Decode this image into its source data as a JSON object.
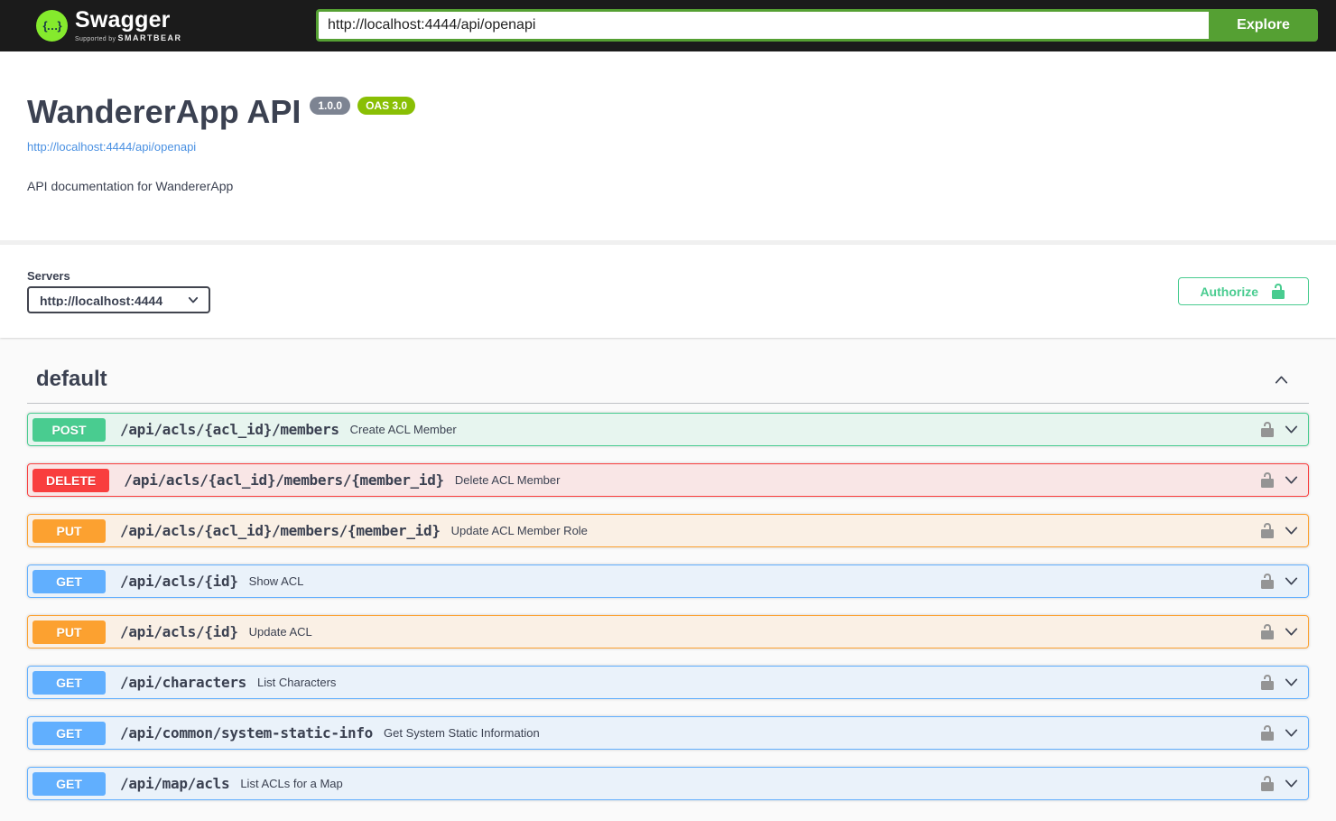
{
  "topbar": {
    "logo_text": "Swagger",
    "tagline_prefix": "Supported by",
    "tagline_brand": "SMARTBEAR",
    "url_value": "http://localhost:4444/api/openapi",
    "explore_label": "Explore"
  },
  "info": {
    "title": "WandererApp API",
    "version_badge": "1.0.0",
    "oas_badge": "OAS 3.0",
    "spec_link": "http://localhost:4444/api/openapi",
    "description": "API documentation for WandererApp"
  },
  "scheme": {
    "servers_label": "Servers",
    "server_selected": "http://localhost:4444",
    "authorize_label": "Authorize"
  },
  "section": {
    "title": "default"
  },
  "operations": [
    {
      "method": "POST",
      "path": "/api/acls/{acl_id}/members",
      "summary": "Create ACL Member"
    },
    {
      "method": "DELETE",
      "path": "/api/acls/{acl_id}/members/{member_id}",
      "summary": "Delete ACL Member"
    },
    {
      "method": "PUT",
      "path": "/api/acls/{acl_id}/members/{member_id}",
      "summary": "Update ACL Member Role"
    },
    {
      "method": "GET",
      "path": "/api/acls/{id}",
      "summary": "Show ACL"
    },
    {
      "method": "PUT",
      "path": "/api/acls/{id}",
      "summary": "Update ACL"
    },
    {
      "method": "GET",
      "path": "/api/characters",
      "summary": "List Characters"
    },
    {
      "method": "GET",
      "path": "/api/common/system-static-info",
      "summary": "Get System Static Information"
    },
    {
      "method": "GET",
      "path": "/api/map/acls",
      "summary": "List ACLs for a Map"
    }
  ],
  "colors": {
    "get": "#61affe",
    "post": "#49cc90",
    "put": "#fca130",
    "delete": "#f93e3e",
    "authorize_green": "#49cc90",
    "explore_green": "#55a033",
    "link_blue": "#4990e2",
    "topbar_bg": "#1b1b1b",
    "logo_green": "#85ea2d",
    "version_badge_bg": "#7d8492",
    "oas_badge_bg": "#89bf04",
    "lock_gray": "#949494",
    "heading_text": "#3b4151"
  },
  "icons": {
    "logo": "swagger-braces-icon",
    "auth_lock": "unlock-icon",
    "row_lock": "unlock-icon",
    "section_arrow": "chevron-up-icon",
    "row_arrow": "chevron-down-icon",
    "select_arrow": "chevron-down-icon"
  }
}
